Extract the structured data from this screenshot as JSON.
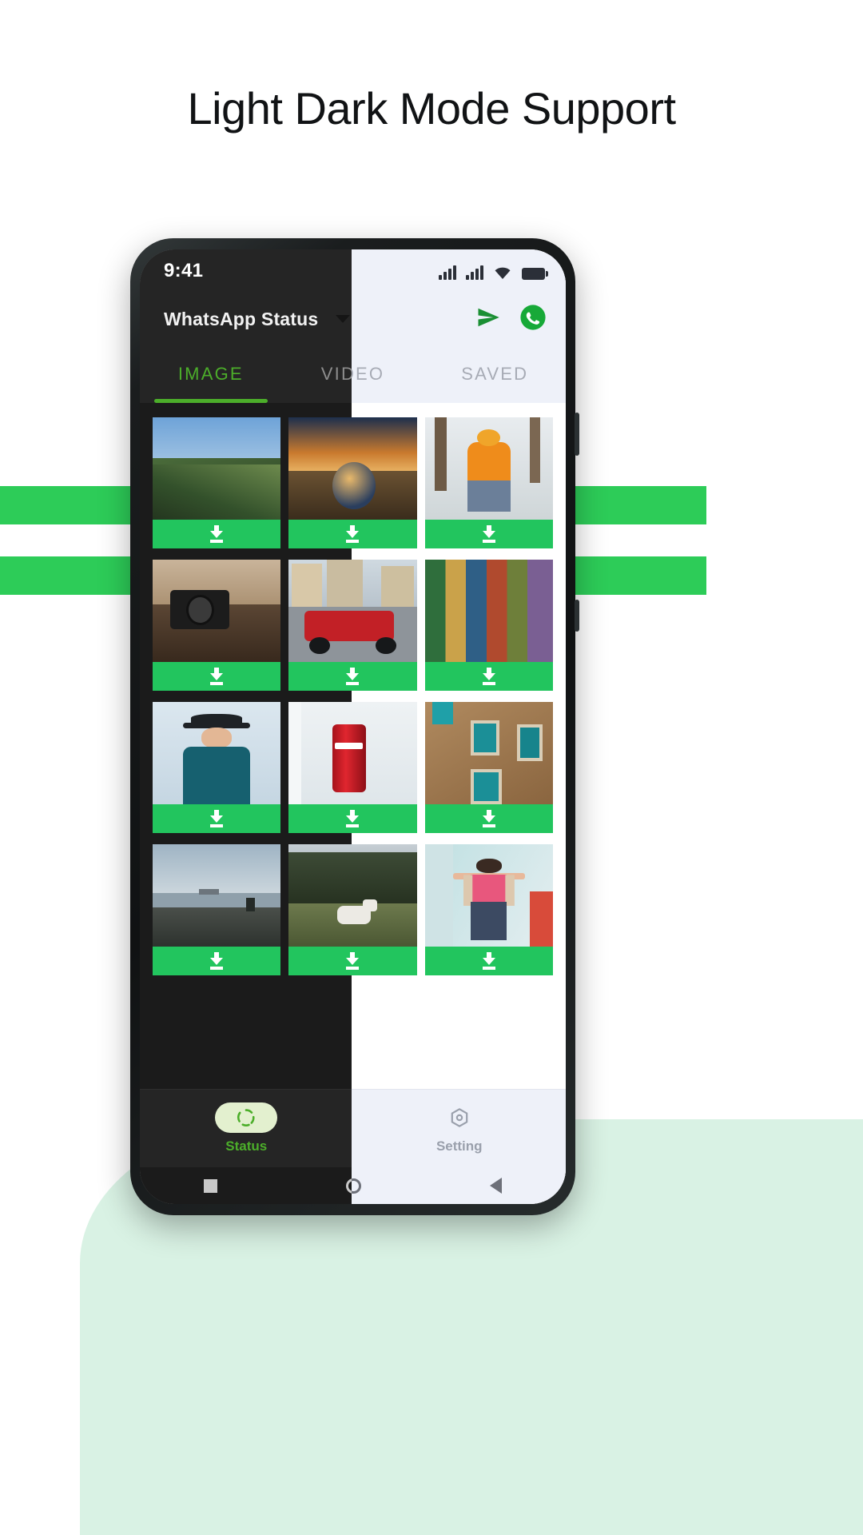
{
  "headline": "Light Dark Mode Support",
  "statusbar": {
    "time": "9:41",
    "icons": [
      "signal-bars-icon",
      "signal-bars-icon",
      "wifi-icon",
      "battery-icon"
    ]
  },
  "appbar": {
    "title": "WhatsApp Status",
    "dropdown_icon": "chevron-down-icon",
    "actions": [
      {
        "name": "send-icon",
        "label": "Send"
      },
      {
        "name": "whatsapp-icon",
        "label": "WhatsApp"
      }
    ]
  },
  "tabs": [
    {
      "label": "IMAGE",
      "active": true
    },
    {
      "label": "VIDEO",
      "active": false
    },
    {
      "label": "SAVED",
      "active": false
    }
  ],
  "grid": {
    "download_label": "Download",
    "items": [
      {
        "caption": "Green mountain peak under blue sky"
      },
      {
        "caption": "Lens ball on sand at sunset"
      },
      {
        "caption": "Woman in orange jacket sitting in snow"
      },
      {
        "caption": "Vintage camera on leather notebook"
      },
      {
        "caption": "Red jeep parked on city street"
      },
      {
        "caption": "Wall of printed travel postcards"
      },
      {
        "caption": "Boy in teal shirt wearing a black hat"
      },
      {
        "caption": "Red soda can on a windowsill"
      },
      {
        "caption": "Stone building with teal shutters"
      },
      {
        "caption": "Two people on cliff overlooking sea"
      },
      {
        "caption": "White horse in a green forest field"
      },
      {
        "caption": "Girl with arms outstretched by glass wall"
      }
    ]
  },
  "bottom_nav": [
    {
      "label": "Status",
      "icon": "status-ring-icon",
      "active": true
    },
    {
      "label": "Setting",
      "icon": "gear-hex-icon",
      "active": false
    }
  ],
  "system_nav": [
    {
      "name": "recents-button",
      "icon": "square-icon"
    },
    {
      "name": "home-button",
      "icon": "circle-icon"
    },
    {
      "name": "back-button",
      "icon": "triangle-left-icon"
    }
  ],
  "colors": {
    "accent_green": "#22c55e",
    "tab_green": "#4cae2a",
    "dark_bg": "#1b1b1b",
    "dark_surface": "#252525",
    "light_bg": "#ffffff",
    "light_surface": "#eef1f9",
    "mint": "#d9f2e4",
    "stripe": "#2dcc58"
  }
}
